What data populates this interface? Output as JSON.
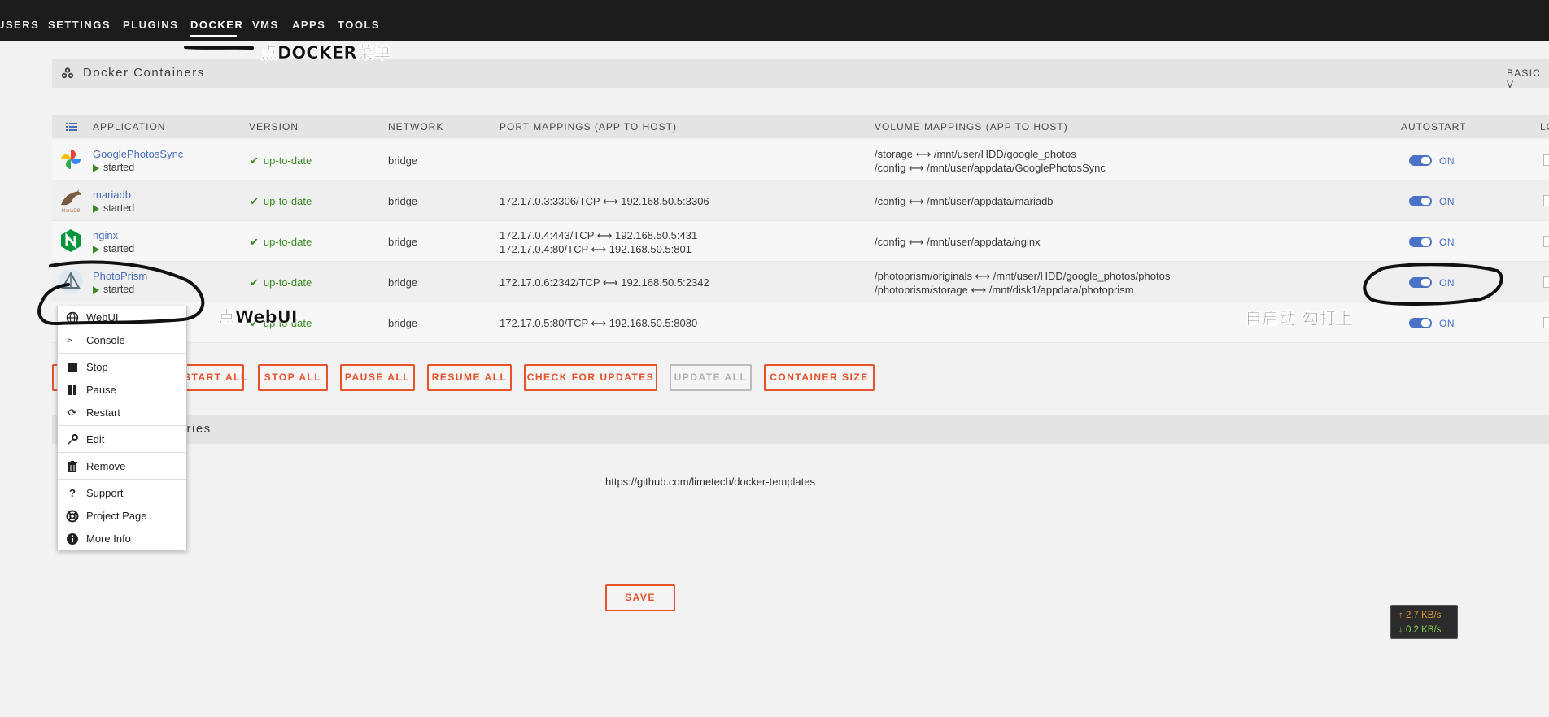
{
  "nav": {
    "items": [
      "USERS",
      "SETTINGS",
      "PLUGINS",
      "DOCKER",
      "VMS",
      "APPS",
      "TOOLS"
    ],
    "active": "DOCKER"
  },
  "annotations": {
    "docker_menu": "点DOCKER菜单",
    "webui": "点WebUI",
    "autostart": "自启动 勾打上"
  },
  "containers_section": {
    "title": "Docker Containers",
    "basic_view": "BASIC V"
  },
  "table": {
    "headers": {
      "application": "APPLICATION",
      "version": "VERSION",
      "network": "NETWORK",
      "ports": "PORT MAPPINGS (APP TO HOST)",
      "volumes": "VOLUME MAPPINGS (APP TO HOST)",
      "autostart": "AUTOSTART",
      "log": "LO"
    },
    "rows": [
      {
        "name": "GooglePhotosSync",
        "state": "started",
        "version": "up-to-date",
        "network": "bridge",
        "port1": "",
        "port2": "",
        "vol1": "/storage ⟷ /mnt/user/HDD/google_photos",
        "vol2": "/config ⟷ /mnt/user/appdata/GooglePhotosSync",
        "autostart": "ON"
      },
      {
        "name": "mariadb",
        "state": "started",
        "version": "up-to-date",
        "network": "bridge",
        "port1": "172.17.0.3:3306/TCP ⟷ 192.168.50.5:3306",
        "port2": "",
        "vol1": "/config ⟷ /mnt/user/appdata/mariadb",
        "vol2": "",
        "autostart": "ON"
      },
      {
        "name": "nginx",
        "state": "started",
        "version": "up-to-date",
        "network": "bridge",
        "port1": "172.17.0.4:443/TCP ⟷ 192.168.50.5:431",
        "port2": "172.17.0.4:80/TCP ⟷ 192.168.50.5:801",
        "vol1": "/config ⟷ /mnt/user/appdata/nginx",
        "vol2": "",
        "autostart": "ON"
      },
      {
        "name": "PhotoPrism",
        "state": "started",
        "version": "up-to-date",
        "network": "bridge",
        "port1": "172.17.0.6:2342/TCP ⟷ 192.168.50.5:2342",
        "port2": "",
        "vol1": "/photoprism/originals ⟷ /mnt/user/HDD/google_photos/photos",
        "vol2": "/photoprism/storage ⟷ /mnt/disk1/appdata/photoprism",
        "autostart": "ON"
      },
      {
        "name": "",
        "state": "",
        "version": "up-to-date",
        "network": "bridge",
        "port1": "172.17.0.5:80/TCP ⟷ 192.168.50.5:8080",
        "port2": "",
        "vol1": "",
        "vol2": "",
        "autostart": "ON"
      }
    ]
  },
  "buttons": {
    "start_all": "START ALL",
    "stop_all": "STOP ALL",
    "pause_all": "PAUSE ALL",
    "resume_all": "RESUME ALL",
    "check_updates": "CHECK FOR UPDATES",
    "update_all": "UPDATE ALL",
    "container_size": "CONTAINER SIZE"
  },
  "repos_section": {
    "title": "tories",
    "url": "https://github.com/limetech/docker-templates",
    "save": "SAVE"
  },
  "context_menu": {
    "items": [
      "WebUI",
      "Console",
      "Stop",
      "Pause",
      "Restart",
      "Edit",
      "Remove",
      "Support",
      "Project Page",
      "More Info"
    ]
  },
  "speed": {
    "up": "↑ 2.7 KB/s",
    "down": "↓ 0.2 KB/s"
  },
  "colors": {
    "nav_bg": "#1c1c1c",
    "accent_orange": "#e5522c",
    "link_blue": "#486dba",
    "status_green": "#3c8a26",
    "toggle_blue": "#4a73c8"
  }
}
